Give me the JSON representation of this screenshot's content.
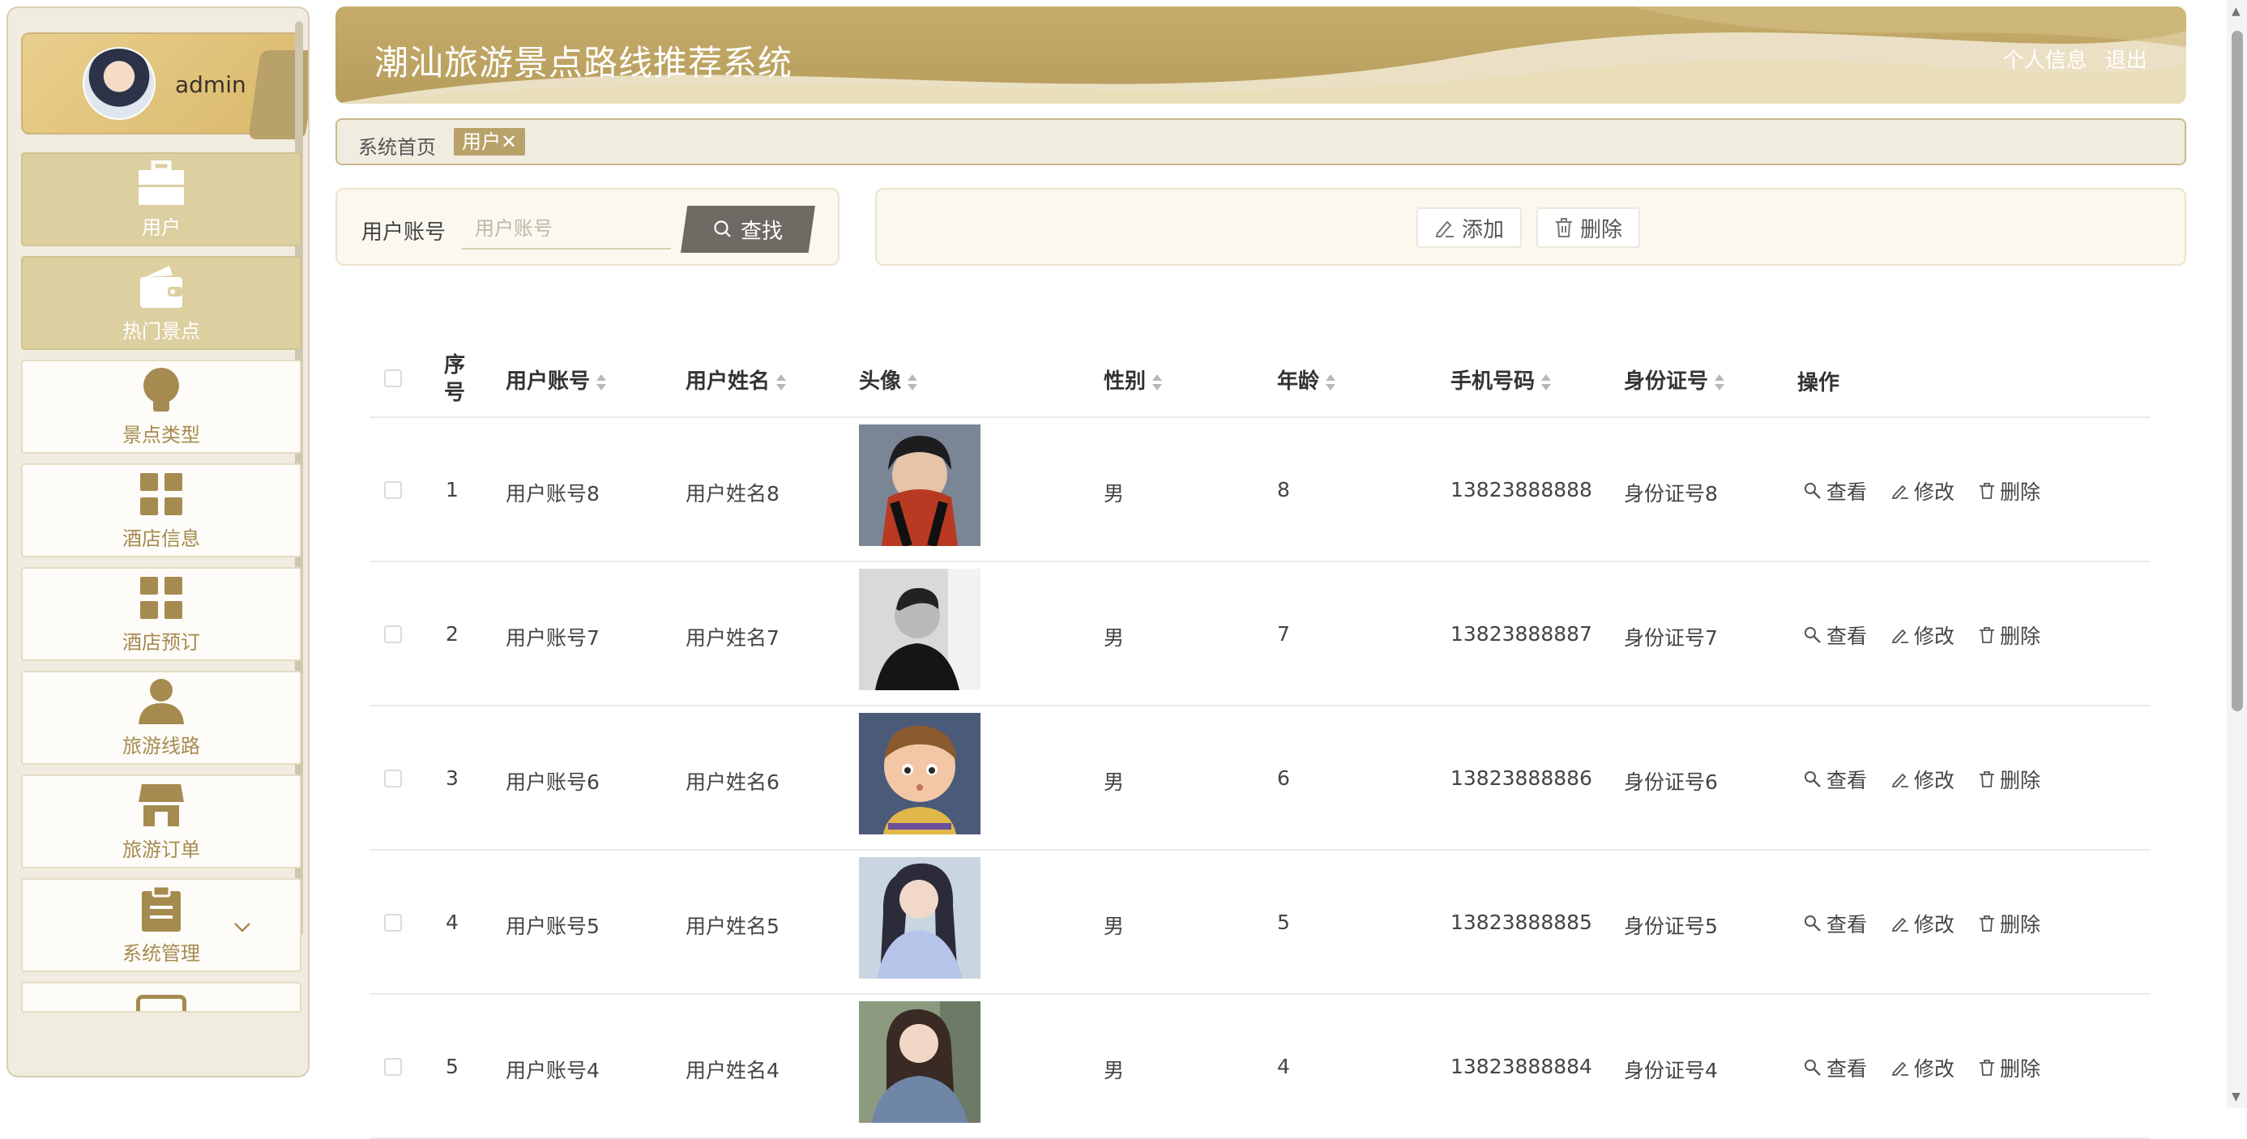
{
  "app": {
    "title": "潮汕旅游景点路线推荐系统"
  },
  "header": {
    "profile_link": "个人信息",
    "logout_link": "退出"
  },
  "user": {
    "name": "admin"
  },
  "sidebar": {
    "items": [
      {
        "label": "用户",
        "icon": "briefcase-icon",
        "active": true
      },
      {
        "label": "热门景点",
        "icon": "wallet-icon",
        "active": true
      },
      {
        "label": "景点类型",
        "icon": "lightbulb-icon",
        "active": false
      },
      {
        "label": "酒店信息",
        "icon": "grid-icon",
        "active": false
      },
      {
        "label": "酒店预订",
        "icon": "grid-icon",
        "active": false
      },
      {
        "label": "旅游线路",
        "icon": "person-icon",
        "active": false
      },
      {
        "label": "旅游订单",
        "icon": "shop-icon",
        "active": false
      },
      {
        "label": "系统管理",
        "icon": "clipboard-icon",
        "active": false
      }
    ]
  },
  "breadcrumb": {
    "home": "系统首页",
    "current_tag": "用户✕"
  },
  "search": {
    "label": "用户账号",
    "placeholder": "用户账号",
    "button": "查找"
  },
  "actions": {
    "add": "添加",
    "delete": "删除"
  },
  "table": {
    "columns": [
      "序号",
      "用户账号",
      "用户姓名",
      "头像",
      "性别",
      "年龄",
      "手机号码",
      "身份证号",
      "操作"
    ],
    "row_actions": {
      "view": "查看",
      "edit": "修改",
      "delete": "删除"
    },
    "rows": [
      {
        "index": "1",
        "account": "用户账号8",
        "name": "用户姓名8",
        "gender": "男",
        "age": "8",
        "phone": "13823888888",
        "id_card": "身份证号8"
      },
      {
        "index": "2",
        "account": "用户账号7",
        "name": "用户姓名7",
        "gender": "男",
        "age": "7",
        "phone": "13823888887",
        "id_card": "身份证号7"
      },
      {
        "index": "3",
        "account": "用户账号6",
        "name": "用户姓名6",
        "gender": "男",
        "age": "6",
        "phone": "13823888886",
        "id_card": "身份证号6"
      },
      {
        "index": "4",
        "account": "用户账号5",
        "name": "用户姓名5",
        "gender": "男",
        "age": "5",
        "phone": "13823888885",
        "id_card": "身份证号5"
      },
      {
        "index": "5",
        "account": "用户账号4",
        "name": "用户姓名4",
        "gender": "男",
        "age": "4",
        "phone": "13823888884",
        "id_card": "身份证号4"
      }
    ]
  },
  "colors": {
    "accent": "#b9a26a",
    "menu_text": "#a68b50",
    "sidebar_bg": "#f1ece0"
  }
}
